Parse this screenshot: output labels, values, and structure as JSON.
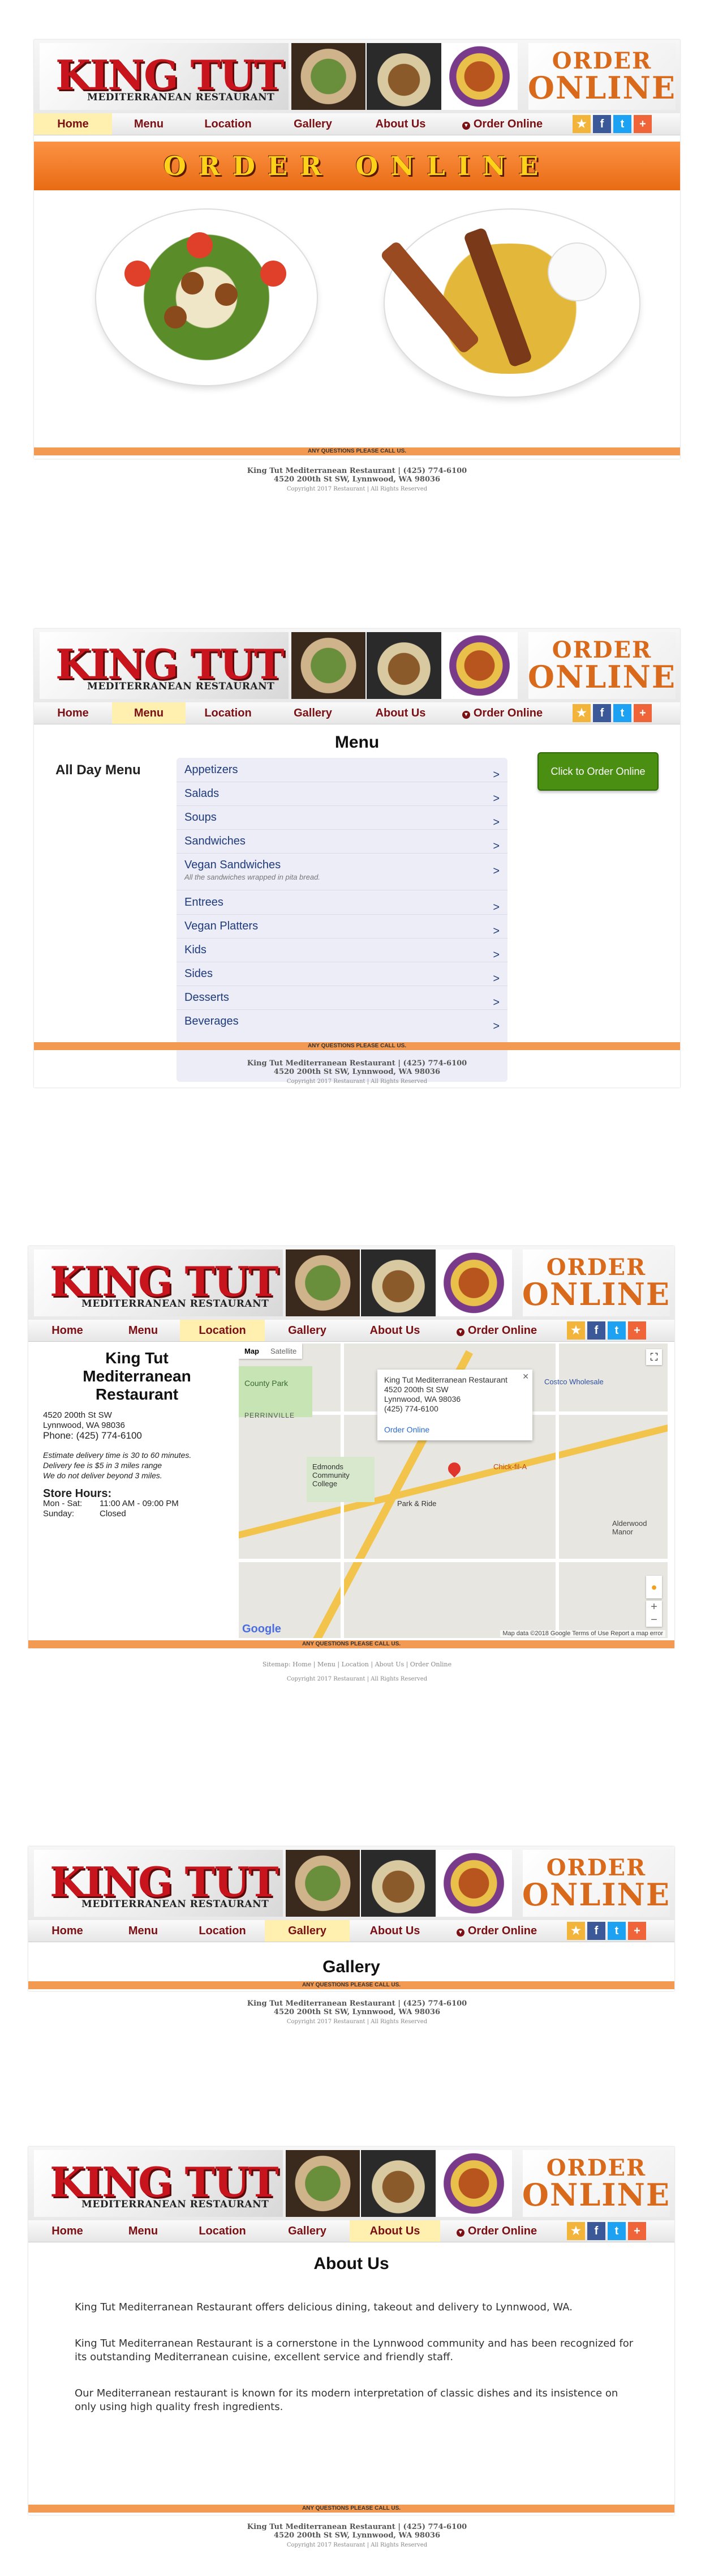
{
  "header": {
    "logo_title": "KING TUT",
    "logo_subtitle": "MEDITERRANEAN RESTAURANT",
    "order_line1": "ORDER",
    "order_line2": "ONLINE"
  },
  "nav": {
    "home": "Home",
    "menu": "Menu",
    "location": "Location",
    "gallery": "Gallery",
    "about": "About Us",
    "order": "Order Online"
  },
  "social": {
    "star": "★",
    "facebook": "f",
    "twitter": "t",
    "plus": "+"
  },
  "home": {
    "banner": "ORDER ONLINE"
  },
  "menu_page": {
    "title": "Menu",
    "side_label": "All Day Menu",
    "order_button": "Click to Order Online",
    "items": [
      {
        "label": "Appetizers",
        "sub": ""
      },
      {
        "label": "Salads",
        "sub": ""
      },
      {
        "label": "Soups",
        "sub": ""
      },
      {
        "label": "Sandwiches",
        "sub": ""
      },
      {
        "label": "Vegan Sandwiches",
        "sub": "All the sandwiches wrapped in pita bread."
      },
      {
        "label": "Entrees",
        "sub": ""
      },
      {
        "label": "Vegan Platters",
        "sub": ""
      },
      {
        "label": "Kids",
        "sub": ""
      },
      {
        "label": "Sides",
        "sub": ""
      },
      {
        "label": "Desserts",
        "sub": ""
      },
      {
        "label": "Beverages",
        "sub": ""
      }
    ],
    "chevron": ">"
  },
  "location_page": {
    "name_line1": "King Tut",
    "name_line2": "Mediterranean",
    "name_line3": "Restaurant",
    "address1": "4520 200th St SW",
    "address2": "Lynnwood, WA 98036",
    "phone": "Phone: (425) 774-6100",
    "delivery1": "Estimate delivery time is 30 to 60 minutes.",
    "delivery2": "Delivery fee is $5 in 3 miles range",
    "delivery3": "We do not deliver beyond 3 miles.",
    "hours_title": "Store Hours:",
    "hours_row1_day": "Mon - Sat:",
    "hours_row1_time": "11:00 AM - 09:00 PM",
    "hours_row2_day": "Sunday:",
    "hours_row2_time": "Closed",
    "map": {
      "tab_map": "Map",
      "tab_satellite": "Satellite",
      "popup_name": "King Tut Mediterranean Restaurant",
      "popup_addr1": "4520 200th St SW",
      "popup_addr2": "Lynnwood, WA 98036",
      "popup_phone": "(425) 774-6100",
      "popup_link": "Order Online",
      "label_costco": "Costco Wholesale",
      "label_county_park": "County Park",
      "label_perrinville": "PERRINVILLE",
      "label_college": "Edmonds Community College",
      "label_chick": "Chick-fil-A",
      "label_park_ride": "Park & Ride",
      "label_alderwood": "Alderwood Manor",
      "google": "Google",
      "attribution": "Map data ©2018 Google   Terms of Use   Report a map error",
      "zoom_in": "+",
      "zoom_out": "−"
    },
    "sitemap": "Sitemap: Home | Menu | Location | About Us | Order Online"
  },
  "gallery_page": {
    "title": "Gallery"
  },
  "about_page": {
    "title": "About Us",
    "p1": "King Tut Mediterranean Restaurant offers delicious dining, takeout and delivery to Lynnwood, WA.",
    "p2": "King Tut Mediterranean Restaurant is a cornerstone in the Lynnwood community and has been recognized for its outstanding Mediterranean cuisine, excellent service and friendly staff.",
    "p3": "Our Mediterranean restaurant is known for its modern interpretation of classic dishes and its insistence on only using high quality fresh ingredients."
  },
  "footer": {
    "bar": "ANY QUESTIONS PLEASE CALL US.",
    "line1": "King Tut Mediterranean Restaurant | (425) 774-6100",
    "line2": "4520 200th St SW, Lynnwood, WA 98036",
    "copyright": "Copyright 2017 Restaurant | All Rights Reserved"
  },
  "colors": {
    "brand_red": "#c8141c",
    "nav_text": "#7a0f14",
    "orange": "#e96b14",
    "menu_link": "#1e3a7a",
    "order_green": "#4a8f12"
  }
}
